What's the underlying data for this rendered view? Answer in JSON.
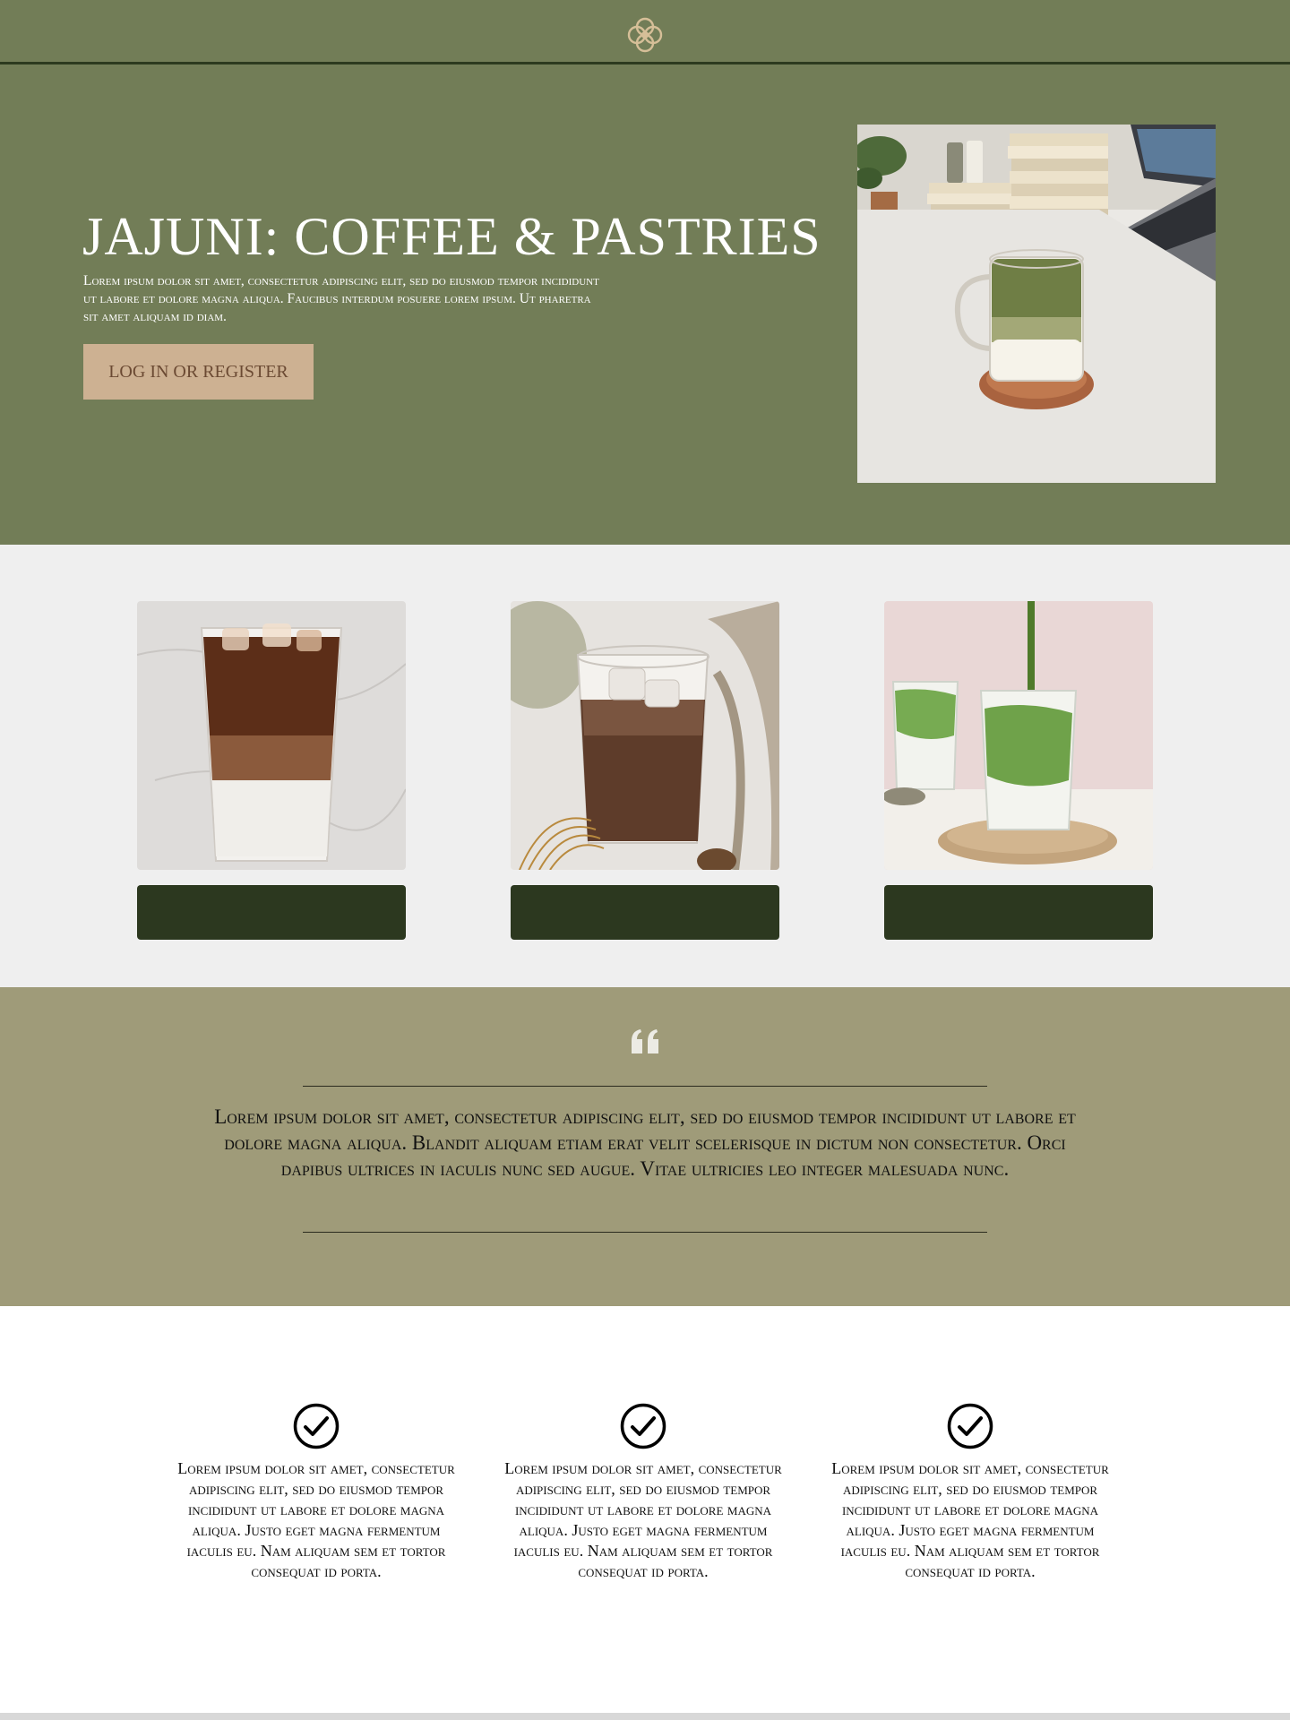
{
  "header": {
    "logo_icon": "quatrefoil-logo-icon"
  },
  "hero": {
    "title": "JAJUNI: COFFEE & PASTRIES",
    "description": "Lorem ipsum dolor sit amet, consectetur adipiscing elit, sed do eiusmod tempor incididunt ut labore et dolore magna aliqua. Faucibus interdum posuere lorem ipsum. Ut pharetra sit amet aliquam id diam.",
    "button_label": "LOG IN OR REGISTER",
    "photo": "iced-matcha-latte-photo"
  },
  "products": {
    "items": [
      {
        "photo": "iced-coffee-latte-photo",
        "button_label": ""
      },
      {
        "photo": "iced-mocha-photo",
        "button_label": ""
      },
      {
        "photo": "matcha-pour-photo",
        "button_label": ""
      }
    ]
  },
  "testimonial": {
    "quote_icon": "quote-icon",
    "text": "Lorem ipsum dolor sit amet, consectetur adipiscing elit, sed do eiusmod tempor incididunt ut labore et dolore magna aliqua. Blandit aliquam etiam erat velit scelerisque in dictum non consectetur. Orci dapibus ultrices in iaculis nunc sed augue. Vitae ultricies leo integer malesuada nunc."
  },
  "features": {
    "items": [
      {
        "icon": "check-circle-icon",
        "text": "Lorem ipsum dolor sit amet, consectetur adipiscing elit, sed do eiusmod tempor incididunt ut labore et dolore magna aliqua. Justo eget magna fermentum iaculis eu. Nam aliquam sem et tortor consequat id porta."
      },
      {
        "icon": "check-circle-icon",
        "text": "Lorem ipsum dolor sit amet, consectetur adipiscing elit, sed do eiusmod tempor incididunt ut labore et dolore magna aliqua. Justo eget magna fermentum iaculis eu. Nam aliquam sem et tortor consequat id porta."
      },
      {
        "icon": "check-circle-icon",
        "text": "Lorem ipsum dolor sit amet, consectetur adipiscing elit, sed do eiusmod tempor incididunt ut labore et dolore magna aliqua. Justo eget magna fermentum iaculis eu. Nam aliquam sem et tortor consequat id porta."
      }
    ]
  },
  "colors": {
    "header_green": "#727d57",
    "dark_green": "#2c381f",
    "tan_button": "#cdb192",
    "quote_bg": "#9f9b79",
    "products_bg": "#efefef"
  }
}
